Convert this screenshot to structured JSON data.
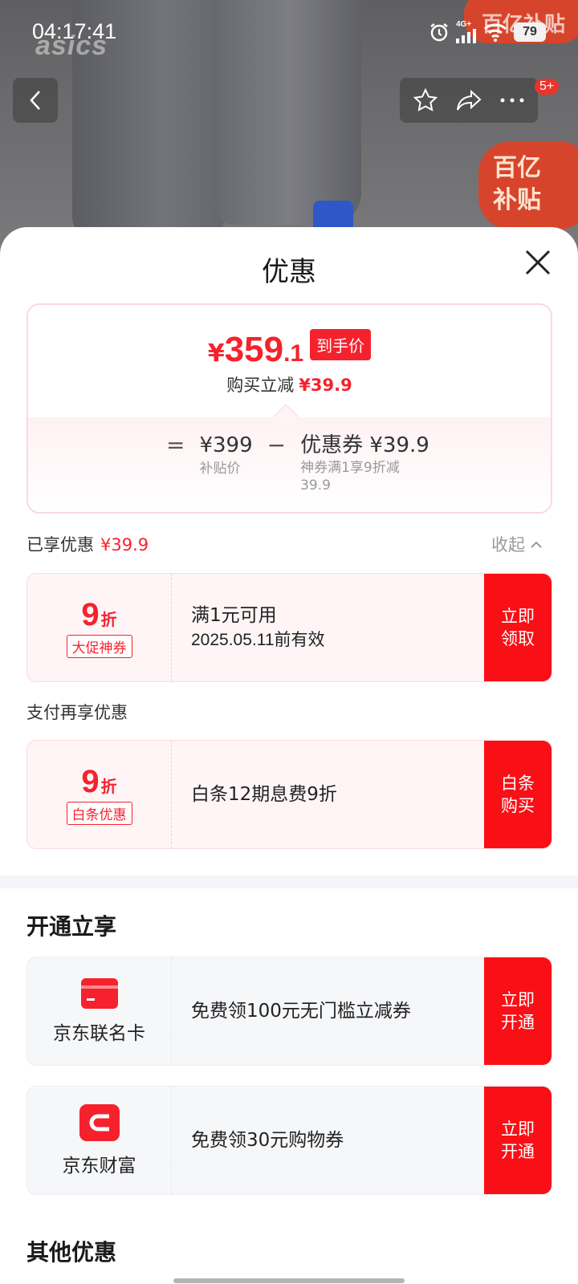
{
  "status_bar": {
    "time": "04:17:41",
    "network": "4G+",
    "battery": "79"
  },
  "photo": {
    "brand": "asics",
    "badge_top": "百亿补贴",
    "badge_line1": "百亿",
    "badge_line2": "补贴",
    "message_count": "5+"
  },
  "sheet": {
    "title": "优惠",
    "price": {
      "symbol": "¥",
      "main": "359",
      "decimal": ".1",
      "tag": "到手价",
      "instant_label": "购买立减",
      "instant_amount": "¥39.9",
      "formula": {
        "eq": "=",
        "base_value": "¥399",
        "base_label": "补贴价",
        "minus": "−",
        "coupon_value": "优惠券 ¥39.9",
        "coupon_desc": "神券满1享9折减39.9"
      }
    },
    "enjoyed_label": "已享优惠",
    "enjoyed_amount": "¥39.9",
    "collapse_label": "收起",
    "coupon1": {
      "discount": "9",
      "unit": "折",
      "tag": "大促神券",
      "line1": "满1元可用",
      "line2": "2025.05.11前有效",
      "button": "立即领取"
    },
    "pay_label": "支付再享优惠",
    "coupon2": {
      "discount": "9",
      "unit": "折",
      "tag": "白条优惠",
      "line1": "白条12期息费9折",
      "button": "白条购买"
    },
    "open_title": "开通立享",
    "card1": {
      "name": "京东联名卡",
      "line1": "免费领100元无门槛立减券",
      "button": "立即开通"
    },
    "card2": {
      "name": "京东财富",
      "line1": "免费领30元购物券",
      "button": "立即开通"
    },
    "other_title": "其他优惠"
  },
  "colors": {
    "accent": "#fa0f16",
    "price_red": "#f5222d",
    "pink_bg": "#fff5f6"
  }
}
